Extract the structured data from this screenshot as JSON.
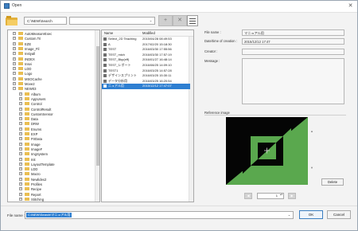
{
  "window": {
    "title": "Open",
    "close_glyph": "✕"
  },
  "toolbar": {
    "folder_icon": "open-folder-icon",
    "path_value": "C:\\NEW\\Search",
    "combo_value": "",
    "combo_arrow": "⌄",
    "buttons": [
      {
        "name": "add-folder-button",
        "icon": "add-folder-icon",
        "glyph": "+"
      },
      {
        "name": "remove-folder-button",
        "icon": "remove-folder-icon",
        "glyph": "✕"
      }
    ],
    "view_icon": "list-view-icon"
  },
  "tree": {
    "items": [
      {
        "label": "AutoMeasureExec",
        "exp": "+"
      },
      {
        "label": "Custom.Tri",
        "exp": "+"
      },
      {
        "label": "EZE",
        "exp": "+"
      },
      {
        "label": "Image_Fil",
        "exp": "+"
      },
      {
        "label": "Instyall",
        "exp": "+"
      },
      {
        "label": "INDEX",
        "exp": "+"
      },
      {
        "label": "Insei",
        "exp": "+"
      },
      {
        "label": "LDD",
        "exp": "+"
      },
      {
        "label": "Logo",
        "exp": "+"
      },
      {
        "label": "MSOCache",
        "exp": "+"
      },
      {
        "label": "Move2",
        "exp": "+"
      },
      {
        "label": "NEW03",
        "exp": "−"
      },
      {
        "label": "Album",
        "exp": "+"
      },
      {
        "label": "AppUsers",
        "exp": "+"
      },
      {
        "label": "Control",
        "exp": "+"
      },
      {
        "label": "ControlResult",
        "exp": "+"
      },
      {
        "label": "CustomSensor",
        "exp": "+"
      },
      {
        "label": "Data",
        "exp": "+"
      },
      {
        "label": "DRW",
        "exp": "+"
      },
      {
        "label": "Enums",
        "exp": "+"
      },
      {
        "label": "EXP",
        "exp": "+"
      },
      {
        "label": "FtrData",
        "exp": "+"
      },
      {
        "label": "Image",
        "exp": "+"
      },
      {
        "label": "ImageF",
        "exp": "+"
      },
      {
        "label": "ImgSystem",
        "exp": "+"
      },
      {
        "label": "Init",
        "exp": "+"
      },
      {
        "label": "LayoutTemplate",
        "exp": "+"
      },
      {
        "label": "LDD",
        "exp": "+"
      },
      {
        "label": "Macro",
        "exp": "+"
      },
      {
        "label": "Newlidex2",
        "exp": "+"
      },
      {
        "label": "Profiles",
        "exp": "+"
      },
      {
        "label": "Recipe",
        "exp": "+"
      },
      {
        "label": "Report",
        "exp": "+"
      },
      {
        "label": "Stitching",
        "exp": "+"
      }
    ]
  },
  "files": {
    "columns": {
      "name": "Name",
      "modified": "Modified"
    },
    "rows": [
      {
        "name": "Select_2D Teaching",
        "modified": "2015/04/28 08:49:53"
      },
      {
        "name": "A",
        "modified": "2017/02/20 15:18:30"
      },
      {
        "name": "TEST",
        "modified": "2016/03/30 17:55:56"
      },
      {
        "name": "TEST_mich",
        "modified": "2016/03/30 17:57:19"
      },
      {
        "name": "TEST_Bkp(eff)",
        "modified": "2016/01/27 16:48:14"
      },
      {
        "name": "TEST_レポート",
        "modified": "2016/08/25 14:09:10"
      },
      {
        "name": "TEST1",
        "modified": "2016/03/25 14:57:28"
      },
      {
        "name": "デザインスプリント",
        "modified": "2016/03/25 15:30:11"
      },
      {
        "name": "データ分析用",
        "modified": "2016/03/25 16:20:54"
      },
      {
        "name": "ニュアル用",
        "modified": "2015/12/12 17:47:07",
        "selected": true
      }
    ]
  },
  "details": {
    "file_name_label": "File name :",
    "file_name_value": "マニュアル用",
    "date_label": "Date/time of creation :",
    "date_value": "2015/12/12 17:47",
    "creator_label": "Creator :",
    "creator_value": "",
    "message_label": "Message :",
    "message_value": ""
  },
  "reference": {
    "label": "Reference image",
    "up_glyph": "▲",
    "down_glyph": "▼",
    "delete_label": "Delete",
    "prev_glyph": "◀",
    "next_glyph": "▶",
    "page_value": "1",
    "spin_glyph": "▴▾"
  },
  "footer": {
    "file_name_label": "File name :",
    "file_name_value": "C:\\NEW\\Search\\マニュアル用",
    "arrow": "⌄",
    "ok_label": "OK",
    "cancel_label": "Cancel"
  },
  "colors": {
    "selection": "#2e7fd1",
    "folder": "#e9be52",
    "reference_green": "#5aa84e"
  }
}
